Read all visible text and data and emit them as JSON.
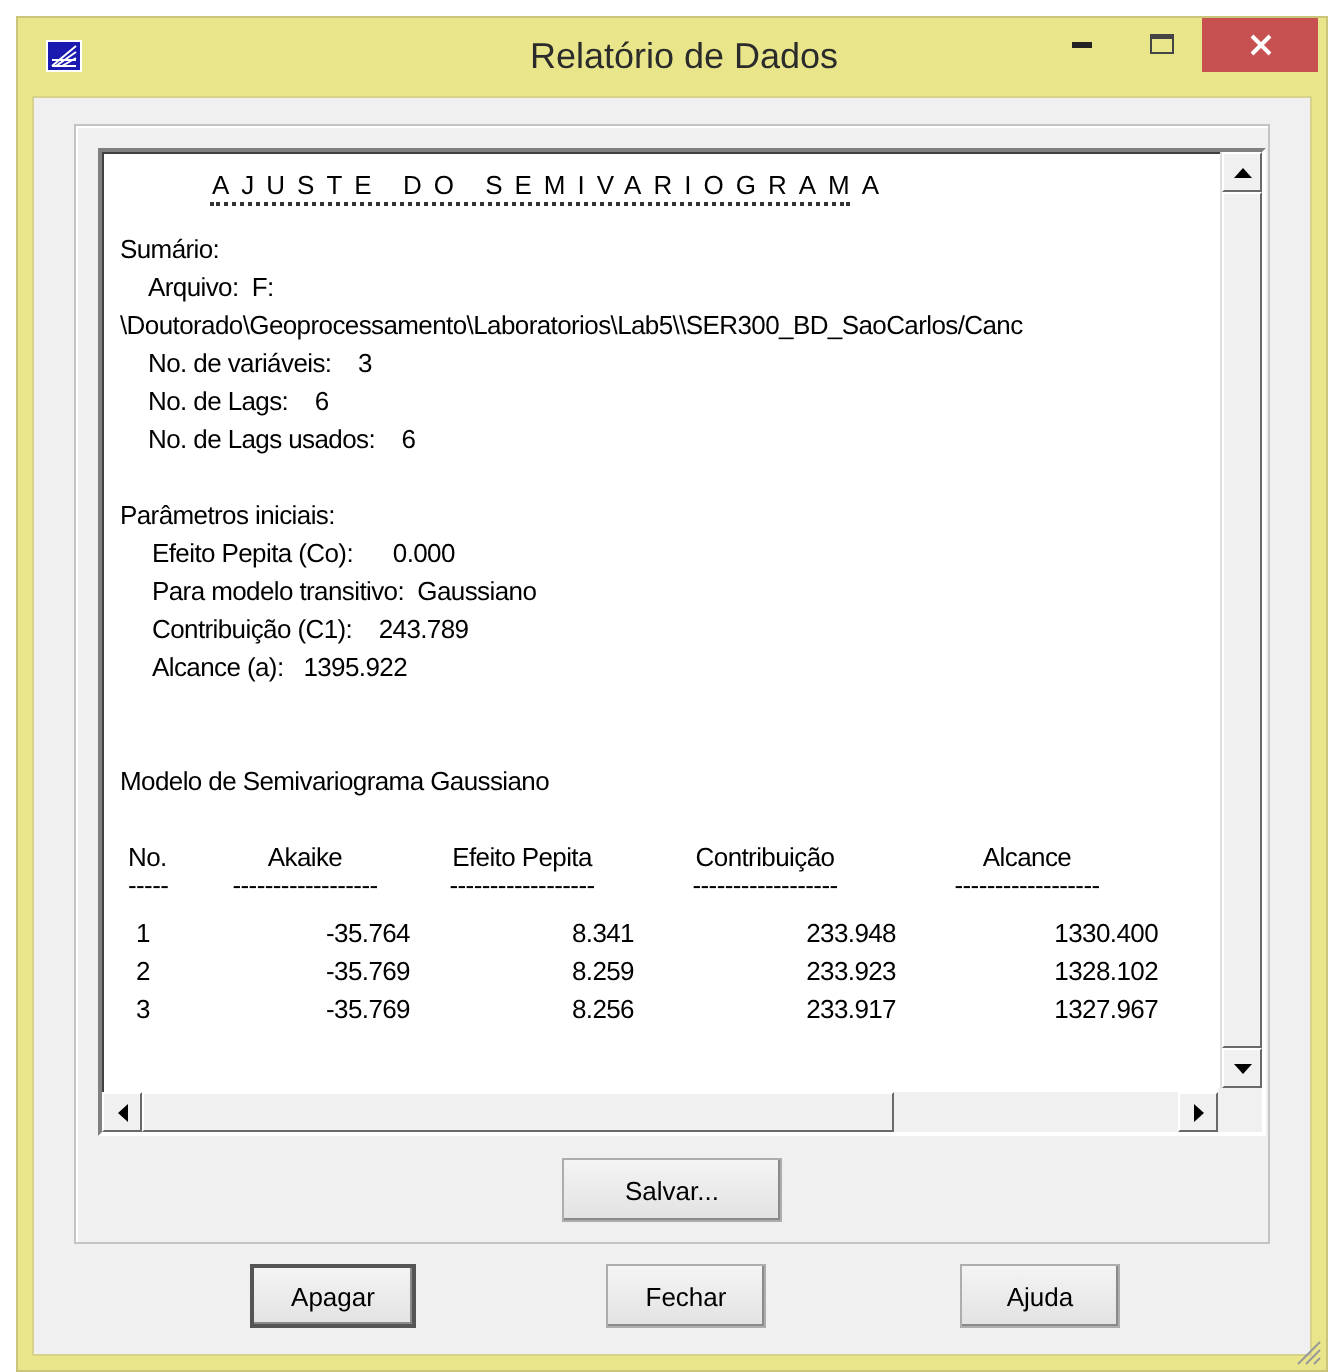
{
  "window": {
    "title": "Relatório de Dados"
  },
  "report": {
    "heading": "AJUSTE DO SEMIVARIOGRAMA",
    "lines": [
      {
        "kind": "label",
        "text": "Sumário:"
      },
      {
        "kind": "item",
        "text": "Arquivo:  F:"
      },
      {
        "kind": "path",
        "text": "\\Doutorado\\Geoprocessamento\\Laboratorios\\Lab5\\\\SER300_BD_SaoCarlos/Canc"
      },
      {
        "kind": "item",
        "text": "No. de variáveis:    3"
      },
      {
        "kind": "item",
        "text": "No. de Lags:    6"
      },
      {
        "kind": "item",
        "text": "No. de Lags usados:    6"
      },
      {
        "kind": "blank"
      },
      {
        "kind": "label",
        "text": "Parâmetros iniciais:"
      },
      {
        "kind": "subitem",
        "text": "Efeito Pepita (Co):      0.000"
      },
      {
        "kind": "subitem",
        "text": "Para modelo transitivo:  Gaussiano"
      },
      {
        "kind": "subitem",
        "text": "Contribuição (C1):    243.789"
      },
      {
        "kind": "subitem",
        "text": "Alcance (a):   1395.922"
      },
      {
        "kind": "blank"
      },
      {
        "kind": "blank"
      },
      {
        "kind": "label",
        "text": "Modelo de Semivariograma Gaussiano"
      },
      {
        "kind": "blank"
      }
    ],
    "table": {
      "columns": [
        "No.",
        "Akaike",
        "Efeito Pepita",
        "Contribuição",
        "Alcance"
      ],
      "separators": [
        "-----",
        "------------------",
        "------------------",
        "------------------",
        "------------------"
      ],
      "rows": [
        [
          "1",
          "-35.764",
          "8.341",
          "233.948",
          "1330.400"
        ],
        [
          "2",
          "-35.769",
          "8.259",
          "233.923",
          "1328.102"
        ],
        [
          "3",
          "-35.769",
          "8.256",
          "233.917",
          "1327.967"
        ]
      ]
    }
  },
  "save_button": {
    "label": "Salvar..."
  },
  "buttons": [
    {
      "label": "Apagar",
      "default": true
    },
    {
      "label": "Fechar",
      "default": false
    },
    {
      "label": "Ajuda",
      "default": false
    }
  ]
}
